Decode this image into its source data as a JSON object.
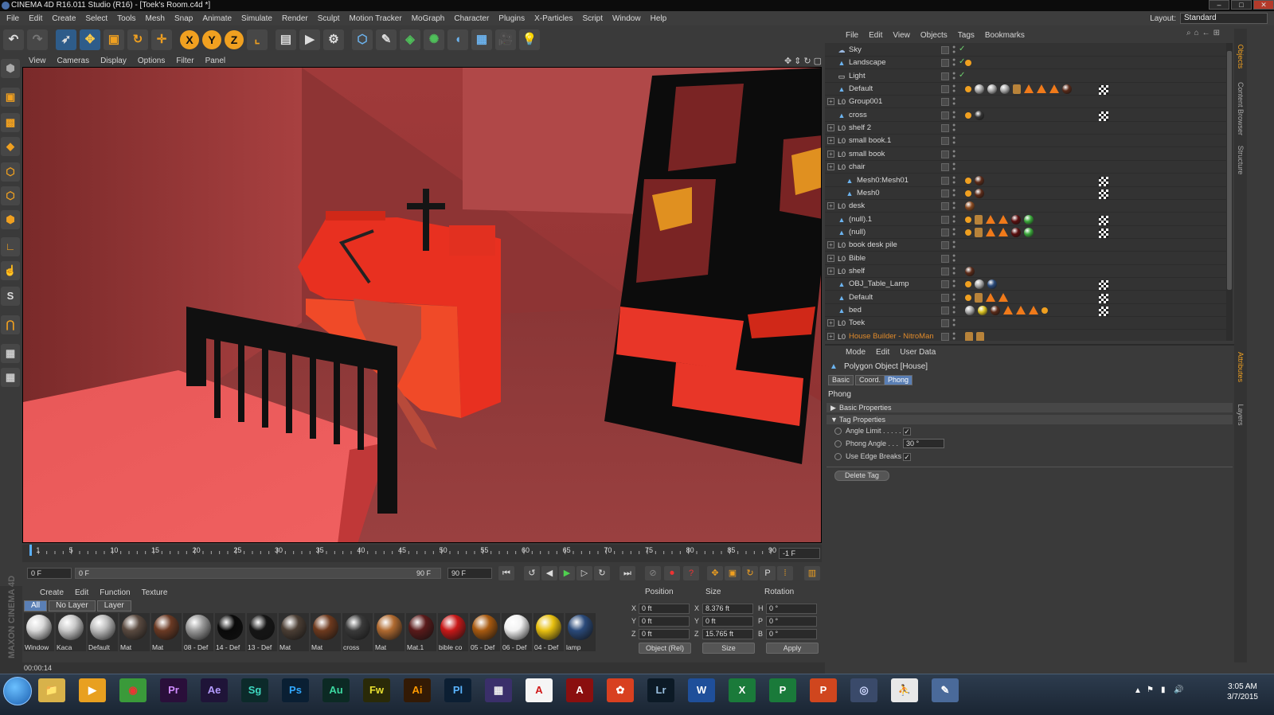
{
  "window": {
    "title": "CINEMA 4D R16.011 Studio (R16) - [Toek's Room.c4d *]"
  },
  "menubar": [
    "File",
    "Edit",
    "Create",
    "Select",
    "Tools",
    "Mesh",
    "Snap",
    "Animate",
    "Simulate",
    "Render",
    "Sculpt",
    "Motion Tracker",
    "MoGraph",
    "Character",
    "Plugins",
    "X-Particles",
    "Script",
    "Window",
    "Help"
  ],
  "layout": {
    "label": "Layout:",
    "value": "Standard"
  },
  "toolbar": {
    "x": "X",
    "y": "Y",
    "z": "Z"
  },
  "viewport": {
    "menu": [
      "View",
      "Cameras",
      "Display",
      "Options",
      "Filter",
      "Panel"
    ]
  },
  "timeline": {
    "ticks": [
      "1",
      "5",
      "10",
      "15",
      "20",
      "25",
      "30",
      "35",
      "40",
      "45",
      "50",
      "55",
      "60",
      "65",
      "70",
      "75",
      "80",
      "85",
      "90"
    ],
    "current_frame": "-1 F",
    "start": "0 F",
    "slider_left": "0 F",
    "slider_right": "90 F",
    "end": "90 F"
  },
  "material_manager": {
    "menu": [
      "Create",
      "Edit",
      "Function",
      "Texture"
    ],
    "filters": [
      "All",
      "No Layer",
      "Layer"
    ],
    "materials": [
      {
        "name": "Window",
        "color": "#d9d9d9"
      },
      {
        "name": "Kaca",
        "color": "#c9c9c9"
      },
      {
        "name": "Default",
        "color": "#bdbdbd"
      },
      {
        "name": "Mat",
        "color": "#5a4a40"
      },
      {
        "name": "Mat",
        "color": "#6b3a24"
      },
      {
        "name": "08 - Def",
        "color": "#9a9a9a"
      },
      {
        "name": "14 - Def",
        "color": "#0a0a0a"
      },
      {
        "name": "13 - Def",
        "color": "#151515"
      },
      {
        "name": "Mat",
        "color": "#4b3e34"
      },
      {
        "name": "Mat",
        "color": "#6e3a1e"
      },
      {
        "name": "cross",
        "color": "#3a3a3a"
      },
      {
        "name": "Mat",
        "color": "#b06a30"
      },
      {
        "name": "Mat.1",
        "color": "#5a1a1a"
      },
      {
        "name": "bible co",
        "color": "#c81818"
      },
      {
        "name": "05 - Def",
        "color": "#a85a10"
      },
      {
        "name": "06 - Def",
        "color": "#f2f2f2"
      },
      {
        "name": "04 - Def",
        "color": "#e8c010"
      },
      {
        "name": "lamp",
        "color": "#2a4a7a"
      }
    ]
  },
  "coordinates": {
    "headers": [
      "Position",
      "Size",
      "Rotation"
    ],
    "rows": [
      {
        "axis": "X",
        "pos": "0 ft",
        "size_axis": "X",
        "size": "8.376 ft",
        "rot_axis": "H",
        "rot": "0 °"
      },
      {
        "axis": "Y",
        "pos": "0 ft",
        "size_axis": "Y",
        "size": "0 ft",
        "rot_axis": "P",
        "rot": "0 °"
      },
      {
        "axis": "Z",
        "pos": "0 ft",
        "size_axis": "Z",
        "size": "15.765 ft",
        "rot_axis": "B",
        "rot": "0 °"
      }
    ],
    "mode": "Object (Rel)",
    "size_mode": "Size",
    "apply": "Apply"
  },
  "status": {
    "time": "00:00:14"
  },
  "brand": "MAXON CINEMA 4D",
  "object_manager": {
    "menu": [
      "File",
      "Edit",
      "View",
      "Objects",
      "Tags",
      "Bookmarks"
    ],
    "objects": [
      {
        "name": "Sky",
        "type": "sky",
        "depth": 0,
        "expand": false,
        "check": true,
        "tags": []
      },
      {
        "name": "Landscape",
        "type": "poly",
        "depth": 0,
        "expand": false,
        "check": true,
        "tags": [
          "ph"
        ]
      },
      {
        "name": "Light",
        "type": "light",
        "depth": 0,
        "expand": false,
        "check": true,
        "tags": []
      },
      {
        "name": "Default",
        "type": "poly",
        "depth": 0,
        "expand": false,
        "check": false,
        "tags": [
          "ph",
          "g",
          "g",
          "g",
          "org",
          "chk",
          "tri",
          "tri",
          "tri",
          "b"
        ]
      },
      {
        "name": "Group001",
        "type": "null",
        "depth": 0,
        "expand": true,
        "check": false,
        "tags": []
      },
      {
        "name": "cross",
        "type": "poly",
        "depth": 0,
        "expand": false,
        "check": false,
        "tags": [
          "ph",
          "chk",
          "k"
        ]
      },
      {
        "name": "shelf 2",
        "type": "null",
        "depth": 0,
        "expand": true,
        "check": false,
        "tags": []
      },
      {
        "name": "small book.1",
        "type": "null",
        "depth": 0,
        "expand": true,
        "check": false,
        "tags": []
      },
      {
        "name": "small book",
        "type": "null",
        "depth": 0,
        "expand": true,
        "check": false,
        "tags": []
      },
      {
        "name": "chair",
        "type": "null",
        "depth": 0,
        "expand": true,
        "check": false,
        "tags": []
      },
      {
        "name": "Mesh0:Mesh01",
        "type": "poly",
        "depth": 1,
        "expand": false,
        "check": false,
        "tags": [
          "ph",
          "chk",
          "b"
        ]
      },
      {
        "name": "Mesh0",
        "type": "poly",
        "depth": 1,
        "expand": false,
        "check": false,
        "tags": [
          "ph",
          "chk",
          "b"
        ]
      },
      {
        "name": "desk",
        "type": "null",
        "depth": 0,
        "expand": true,
        "check": false,
        "tags": [
          "o"
        ]
      },
      {
        "name": "(null).1",
        "type": "poly",
        "depth": 0,
        "expand": false,
        "check": false,
        "tags": [
          "ph",
          "org",
          "chk",
          "tri",
          "tri",
          "r",
          "gr"
        ]
      },
      {
        "name": "(null)",
        "type": "poly",
        "depth": 0,
        "expand": false,
        "check": false,
        "tags": [
          "ph",
          "org",
          "chk",
          "tri",
          "tri",
          "r",
          "gr"
        ]
      },
      {
        "name": "book desk pile",
        "type": "null",
        "depth": 0,
        "expand": true,
        "check": false,
        "tags": []
      },
      {
        "name": "Bible",
        "type": "null",
        "depth": 0,
        "expand": true,
        "check": false,
        "tags": []
      },
      {
        "name": "shelf",
        "type": "null",
        "depth": 0,
        "expand": true,
        "check": false,
        "tags": [
          "b"
        ]
      },
      {
        "name": "OBJ_Table_Lamp",
        "type": "poly",
        "depth": 0,
        "expand": false,
        "check": false,
        "tags": [
          "ph",
          "g",
          "chk",
          "bl"
        ]
      },
      {
        "name": "Default",
        "type": "poly",
        "depth": 0,
        "expand": false,
        "check": false,
        "tags": [
          "ph",
          "org",
          "chk",
          "tri",
          "tri"
        ]
      },
      {
        "name": "bed",
        "type": "poly",
        "depth": 0,
        "expand": false,
        "check": false,
        "tags": [
          "g",
          "y",
          "b",
          "tri",
          "tri",
          "tri",
          "chk",
          "ph"
        ]
      },
      {
        "name": "Toek",
        "type": "null",
        "depth": 0,
        "expand": true,
        "check": false,
        "tags": []
      },
      {
        "name": "House Builder - NitroMan",
        "type": "null",
        "depth": 0,
        "expand": true,
        "check": false,
        "tags": [
          "org",
          "org"
        ],
        "highlight": true
      }
    ]
  },
  "attributes": {
    "menu": [
      "Mode",
      "Edit",
      "User Data"
    ],
    "title": "Polygon Object [House]",
    "tabs": [
      "Basic",
      "Coord.",
      "Phong"
    ],
    "active_tab": "Phong",
    "section_title": "Phong",
    "groups": [
      "Basic Properties",
      "Tag Properties"
    ],
    "props": [
      {
        "label": "Angle Limit . . . . .",
        "checked": true
      },
      {
        "label": "Phong Angle . . .",
        "value": "30 °"
      },
      {
        "label": "Use Edge Breaks",
        "checked": true
      }
    ],
    "button": "Delete Tag"
  },
  "right_tabs": [
    "Objects",
    "Content Browser",
    "Structure",
    "Attributes",
    "Layers"
  ],
  "taskbar": {
    "apps": [
      {
        "label": "📁",
        "bg": "#d8b24a",
        "fg": "#553"
      },
      {
        "label": "▶",
        "bg": "#e8a020",
        "fg": "#fff"
      },
      {
        "label": "◉",
        "bg": "#3a9a3a",
        "fg": "#e33"
      },
      {
        "label": "Pr",
        "bg": "#2a0f3a",
        "fg": "#d08cff"
      },
      {
        "label": "Ae",
        "bg": "#1f1438",
        "fg": "#b49cff"
      },
      {
        "label": "Sg",
        "bg": "#0c2a2a",
        "fg": "#3ed8c0"
      },
      {
        "label": "Ps",
        "bg": "#0a1f33",
        "fg": "#31a8ff"
      },
      {
        "label": "Au",
        "bg": "#0c2a24",
        "fg": "#3cd8a0"
      },
      {
        "label": "Fw",
        "bg": "#2a2a08",
        "fg": "#e8e030"
      },
      {
        "label": "Ai",
        "bg": "#331a05",
        "fg": "#ff9a00"
      },
      {
        "label": "Pl",
        "bg": "#0c1f33",
        "fg": "#5ab4ff"
      },
      {
        "label": "▦",
        "bg": "#3a2f6a",
        "fg": "#eee"
      },
      {
        "label": "A",
        "bg": "#f5f5f5",
        "fg": "#d01818"
      },
      {
        "label": "A",
        "bg": "#8a0f0f",
        "fg": "#fff"
      },
      {
        "label": "✿",
        "bg": "#d84020",
        "fg": "#fff"
      },
      {
        "label": "Lr",
        "bg": "#0c1a26",
        "fg": "#9ac0e0"
      },
      {
        "label": "W",
        "bg": "#1f4f9a",
        "fg": "#fff"
      },
      {
        "label": "X",
        "bg": "#1a7a3a",
        "fg": "#fff"
      },
      {
        "label": "P",
        "bg": "#1a7a3a",
        "fg": "#fff"
      },
      {
        "label": "P",
        "bg": "#d0461e",
        "fg": "#fff"
      },
      {
        "label": "◎",
        "bg": "#3a4a6a",
        "fg": "#cfd8ff"
      },
      {
        "label": "⛹",
        "bg": "#e8e8e8",
        "fg": "#222"
      },
      {
        "label": "✎",
        "bg": "#4a6a9a",
        "fg": "#fff"
      }
    ],
    "time": "3:05 AM",
    "date": "3/7/2015"
  }
}
